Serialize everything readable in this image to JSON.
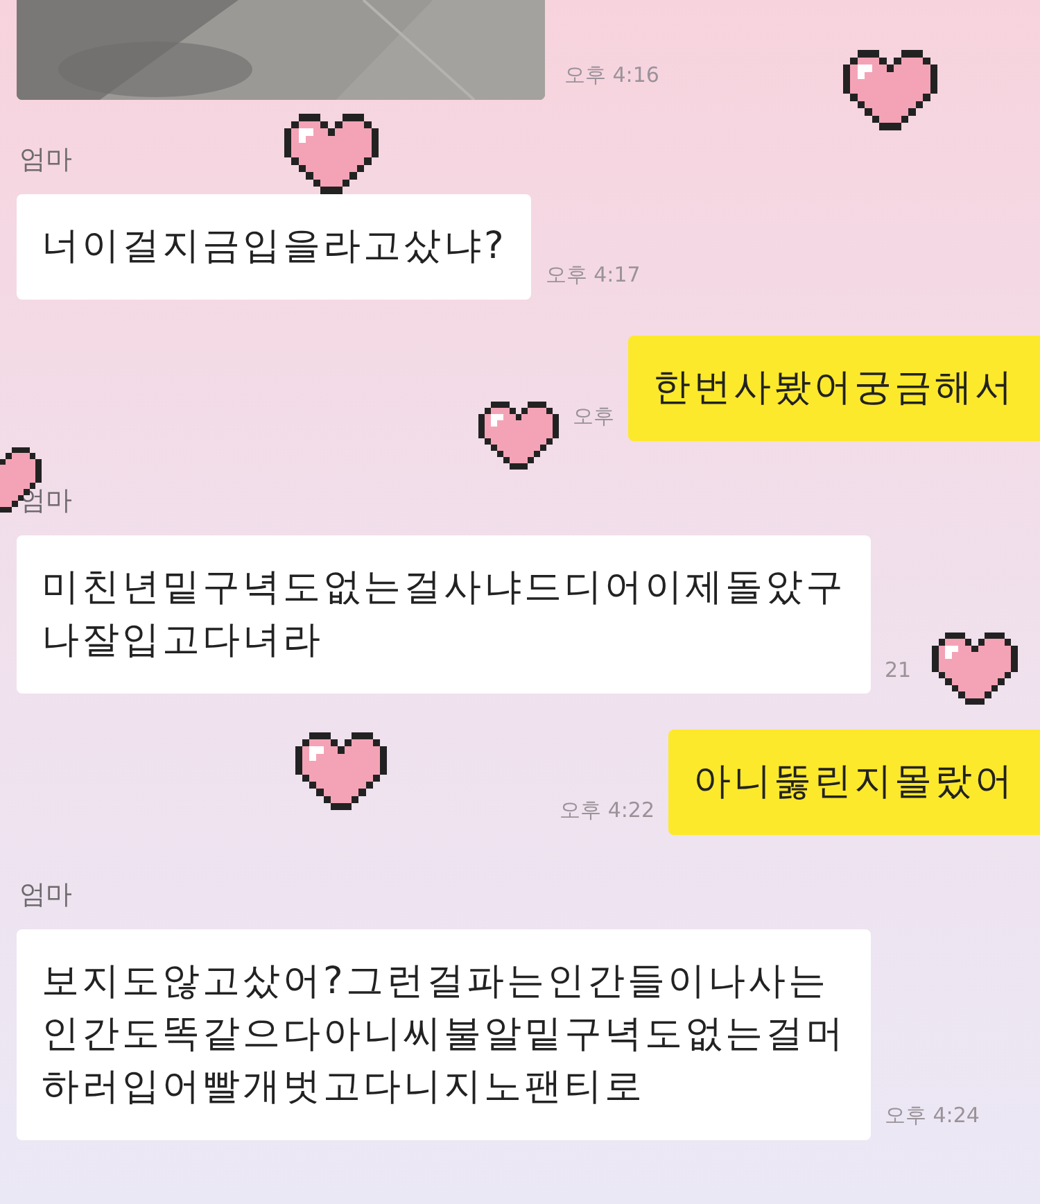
{
  "photo": {
    "kind": "picture",
    "time": "오후 4:16"
  },
  "messages": [
    {
      "kind": "received",
      "sender": "엄마",
      "lines": [
        "너이걸지금입을라고샀냐?"
      ],
      "time": "오후 4:17"
    },
    {
      "kind": "sent",
      "lines": [
        "한번사봤어궁금해서"
      ],
      "time": "오후"
    },
    {
      "kind": "received",
      "sender": "엄마",
      "lines": [
        "미친년밑구녁도없는걸사냐드디어이제돌았구",
        "나잘입고다녀라"
      ],
      "time": "21"
    },
    {
      "kind": "sent",
      "lines": [
        "아니뚫린지몰랐어"
      ],
      "time": "오후 4:22"
    },
    {
      "kind": "received",
      "sender": "엄마",
      "lines": [
        "보지도않고샀어?그런걸파는인간들이나사는",
        "인간도똑같으다아니씨불알밑구녁도없는걸머",
        "하러입어빨개벗고다니지노팬티로"
      ],
      "time": "오후 4:24"
    }
  ]
}
